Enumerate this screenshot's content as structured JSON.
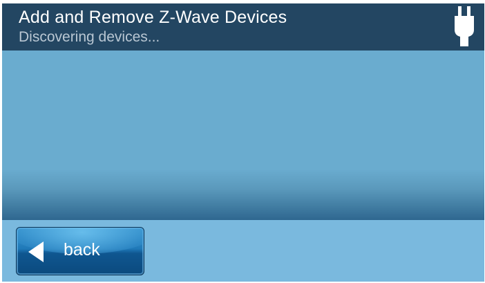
{
  "header": {
    "title": "Add and Remove Z-Wave Devices",
    "status": "Discovering devices...",
    "status_icon": "power-plug-icon"
  },
  "content": {
    "devices": []
  },
  "footer": {
    "back_label": "back",
    "back_icon": "back-arrow-icon"
  },
  "colors": {
    "header_bg": "#234662",
    "content_bg": "#6aaccf",
    "footer_bg": "#7ab9de",
    "button_bg": "#1f79b8",
    "text_primary": "#ffffff",
    "text_secondary": "#b9c7d3"
  }
}
